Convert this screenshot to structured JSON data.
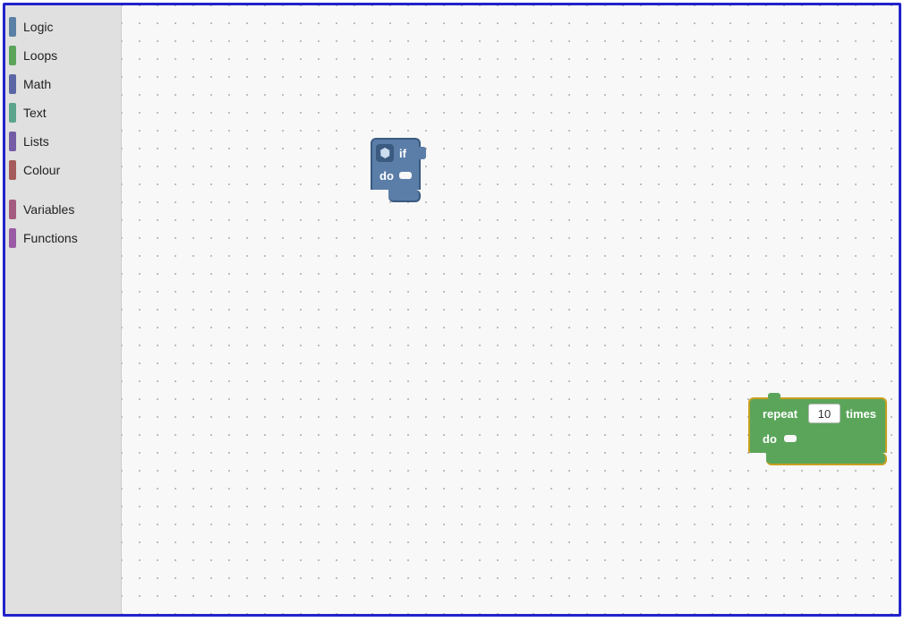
{
  "sidebar": {
    "items": [
      {
        "label": "Logic",
        "color": "#5b80a5",
        "id": "logic"
      },
      {
        "label": "Loops",
        "color": "#5ba55b",
        "id": "loops"
      },
      {
        "label": "Math",
        "color": "#5b67a5",
        "id": "math"
      },
      {
        "label": "Text",
        "color": "#5ba58c",
        "id": "text"
      },
      {
        "label": "Lists",
        "color": "#745ba5",
        "id": "lists"
      },
      {
        "label": "Colour",
        "color": "#a55b5b",
        "id": "colour"
      },
      {
        "label": "Variables",
        "color": "#a55b80",
        "id": "variables"
      },
      {
        "label": "Functions",
        "color": "#9a5ba5",
        "id": "functions"
      }
    ]
  },
  "blocks": {
    "if_block": {
      "top_label": "if",
      "bottom_label": "do",
      "gear_tooltip": "settings"
    },
    "repeat_block": {
      "prefix_label": "repeat",
      "value": "10",
      "suffix_label": "times",
      "do_label": "do"
    }
  }
}
